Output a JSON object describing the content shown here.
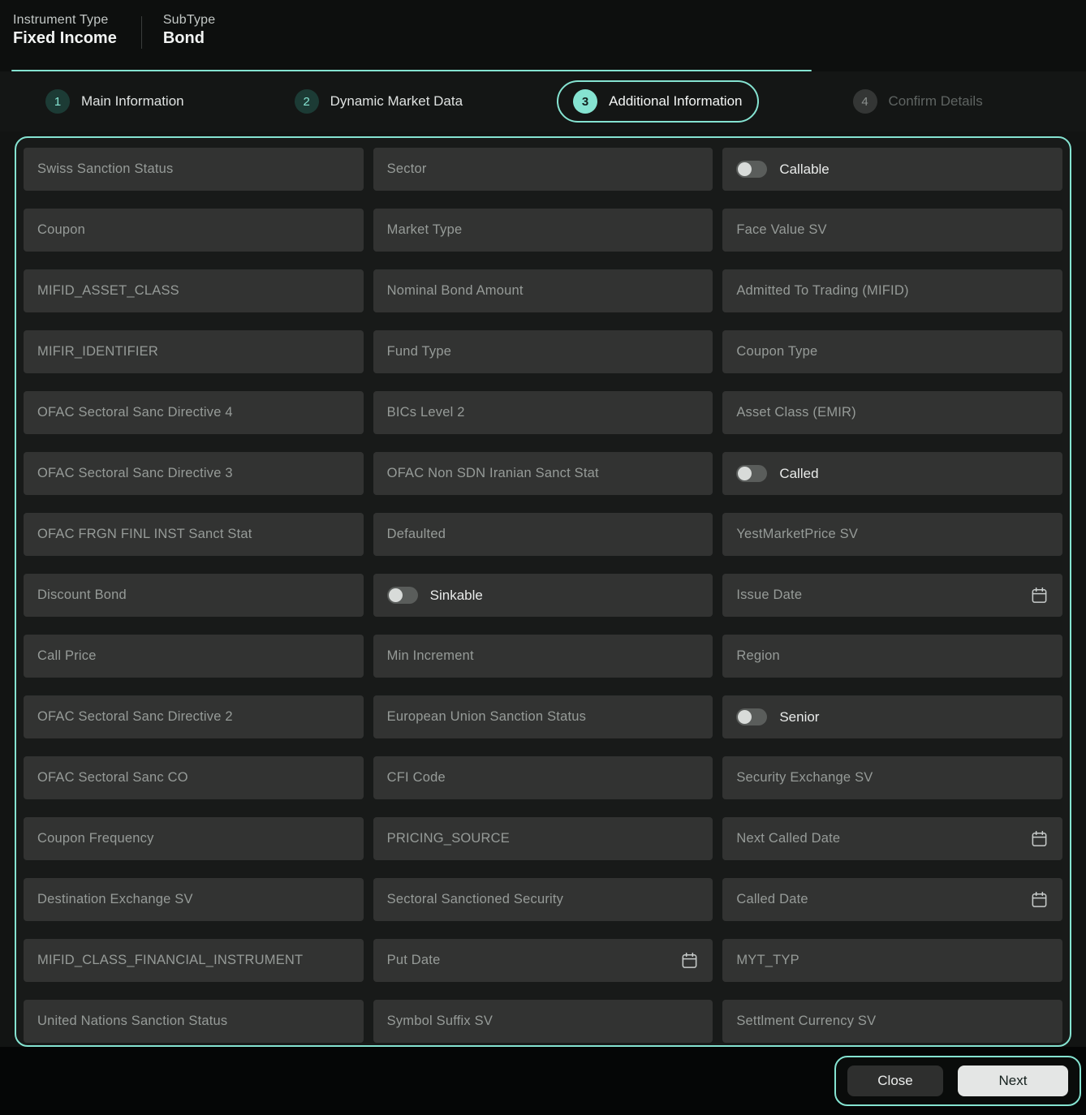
{
  "header": {
    "instrument_type_label": "Instrument Type",
    "instrument_type_value": "Fixed Income",
    "subtype_label": "SubType",
    "subtype_value": "Bond"
  },
  "stepper": {
    "steps": [
      {
        "number": "1",
        "label": "Main Information",
        "state": "done"
      },
      {
        "number": "2",
        "label": "Dynamic Market Data",
        "state": "done"
      },
      {
        "number": "3",
        "label": "Additional Information",
        "state": "active"
      },
      {
        "number": "4",
        "label": "Confirm Details",
        "state": "disabled"
      }
    ]
  },
  "form": {
    "fields": [
      {
        "label": "Swiss Sanction Status",
        "type": "text"
      },
      {
        "label": "Sector",
        "type": "text"
      },
      {
        "label": "Callable",
        "type": "toggle",
        "on": false
      },
      {
        "label": "Coupon",
        "type": "text"
      },
      {
        "label": "Market Type",
        "type": "text"
      },
      {
        "label": "Face Value SV",
        "type": "text"
      },
      {
        "label": "MIFID_ASSET_CLASS",
        "type": "text"
      },
      {
        "label": "Nominal Bond Amount",
        "type": "text"
      },
      {
        "label": "Admitted To Trading (MIFID)",
        "type": "text"
      },
      {
        "label": "MIFIR_IDENTIFIER",
        "type": "text"
      },
      {
        "label": "Fund Type",
        "type": "text"
      },
      {
        "label": "Coupon Type",
        "type": "text"
      },
      {
        "label": "OFAC Sectoral Sanc Directive 4",
        "type": "text"
      },
      {
        "label": "BICs Level 2",
        "type": "text"
      },
      {
        "label": "Asset Class (EMIR)",
        "type": "text"
      },
      {
        "label": "OFAC Sectoral Sanc Directive 3",
        "type": "text"
      },
      {
        "label": "OFAC Non SDN Iranian Sanct Stat",
        "type": "text"
      },
      {
        "label": "Called",
        "type": "toggle",
        "on": false
      },
      {
        "label": "OFAC FRGN FINL INST Sanct Stat",
        "type": "text"
      },
      {
        "label": "Defaulted",
        "type": "text"
      },
      {
        "label": "YestMarketPrice SV",
        "type": "text"
      },
      {
        "label": "Discount Bond",
        "type": "text"
      },
      {
        "label": "Sinkable",
        "type": "toggle",
        "on": false
      },
      {
        "label": "Issue Date",
        "type": "date"
      },
      {
        "label": "Call Price",
        "type": "text"
      },
      {
        "label": "Min Increment",
        "type": "text"
      },
      {
        "label": "Region",
        "type": "text"
      },
      {
        "label": "OFAC Sectoral Sanc Directive 2",
        "type": "text"
      },
      {
        "label": "European Union Sanction Status",
        "type": "text"
      },
      {
        "label": "Senior",
        "type": "toggle",
        "on": false
      },
      {
        "label": "OFAC Sectoral Sanc CO",
        "type": "text"
      },
      {
        "label": "CFI Code",
        "type": "text"
      },
      {
        "label": "Security Exchange SV",
        "type": "text"
      },
      {
        "label": "Coupon Frequency",
        "type": "text"
      },
      {
        "label": "PRICING_SOURCE",
        "type": "text"
      },
      {
        "label": "Next Called Date",
        "type": "date"
      },
      {
        "label": "Destination Exchange SV",
        "type": "text"
      },
      {
        "label": "Sectoral Sanctioned Security",
        "type": "text"
      },
      {
        "label": "Called Date",
        "type": "date"
      },
      {
        "label": "MIFID_CLASS_FINANCIAL_INSTRUMENT",
        "type": "text"
      },
      {
        "label": "Put Date",
        "type": "date"
      },
      {
        "label": "MYT_TYP",
        "type": "text"
      },
      {
        "label": "United Nations Sanction Status",
        "type": "text"
      },
      {
        "label": "Symbol Suffix SV",
        "type": "text"
      },
      {
        "label": "Settlment Currency SV",
        "type": "text"
      }
    ]
  },
  "footer": {
    "close_label": "Close",
    "next_label": "Next"
  },
  "colors": {
    "accent_teal": "#85e3d1",
    "page_background": "#121413",
    "field_background": "#323332",
    "field_label_text": "#969b98",
    "next_button_background": "#e4e6e5",
    "close_button_background": "#2e2f2e"
  }
}
